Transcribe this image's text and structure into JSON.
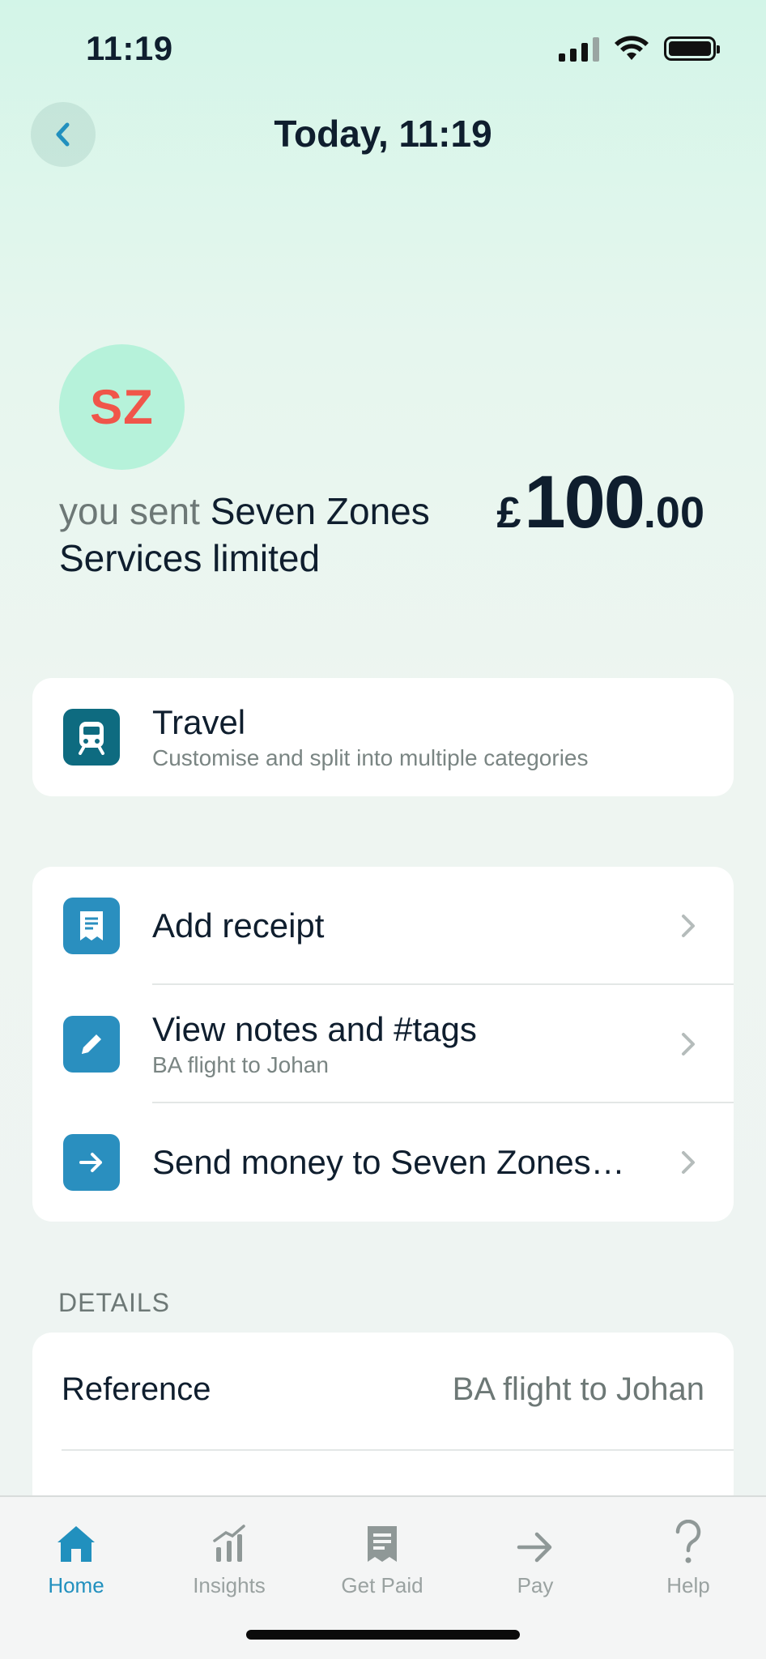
{
  "status_bar": {
    "time": "11:19"
  },
  "header": {
    "title": "Today, 11:19"
  },
  "merchant": {
    "initials": "SZ",
    "sent_prefix": "you sent",
    "name": "Seven Zones Services limited",
    "amount_currency": "£",
    "amount_major": "100",
    "amount_minor": ".00"
  },
  "category_card": {
    "title": "Travel",
    "subtitle": "Customise and split into multiple categories"
  },
  "actions": [
    {
      "title": "Add receipt",
      "subtitle": ""
    },
    {
      "title": "View notes and #tags",
      "subtitle": "BA flight to Johan"
    },
    {
      "title": "Send money to Seven Zones…",
      "subtitle": ""
    }
  ],
  "details": {
    "section_label": "DETAILS",
    "rows": [
      {
        "key": "Reference",
        "value": "BA flight to Johan"
      }
    ]
  },
  "tab_bar": {
    "tabs": [
      {
        "label": "Home",
        "icon": "home-icon",
        "active": true
      },
      {
        "label": "Insights",
        "icon": "insights-icon",
        "active": false
      },
      {
        "label": "Get Paid",
        "icon": "receipt-icon",
        "active": false
      },
      {
        "label": "Pay",
        "icon": "arrow-right-icon",
        "active": false
      },
      {
        "label": "Help",
        "icon": "question-icon",
        "active": false
      }
    ]
  },
  "colors": {
    "accent": "#2190be",
    "travel_icon_bg": "#0e6b80",
    "action_icon_bg": "#2a8fbf",
    "avatar_bg": "#b6f2da",
    "avatar_text": "#f0554a"
  }
}
